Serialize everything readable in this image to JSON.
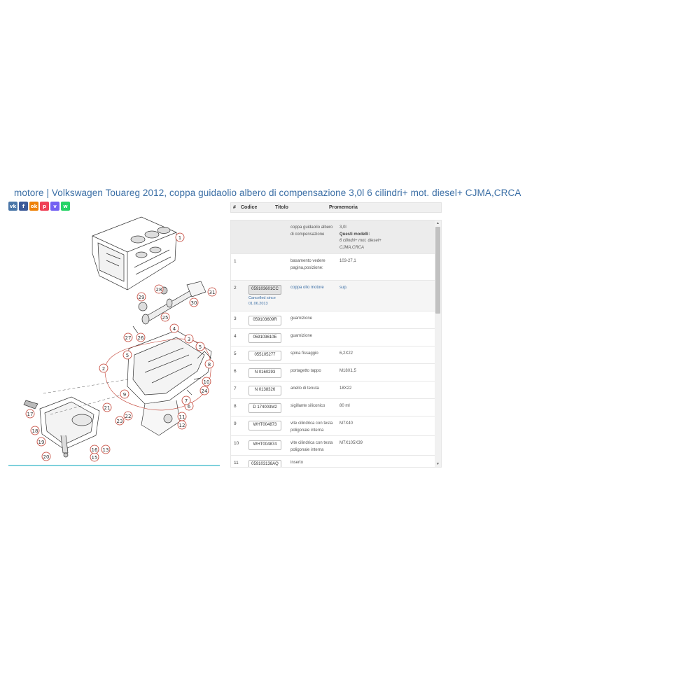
{
  "page": {
    "title": "motore | Volkswagen Touareg 2012, coppa guidaolio albero di compensazione 3,0l 6 cilindri+ mot. diesel+ CJMA,CRCA"
  },
  "share": [
    {
      "name": "vk-icon",
      "glyph": "vk",
      "color": "#4a76a8"
    },
    {
      "name": "facebook-icon",
      "glyph": "f",
      "color": "#3b5998"
    },
    {
      "name": "odnoklassniki-icon",
      "glyph": "ok",
      "color": "#ee8208"
    },
    {
      "name": "pocket-icon",
      "glyph": "p",
      "color": "#ef4056"
    },
    {
      "name": "viber-icon",
      "glyph": "v",
      "color": "#7360f2"
    },
    {
      "name": "whatsapp-icon",
      "glyph": "w",
      "color": "#25d366"
    }
  ],
  "table": {
    "headers": {
      "num": "#",
      "code": "Codice",
      "title": "Titolo",
      "memo": "Promemoria"
    },
    "group": {
      "title": "coppa guidaolio albero di compensazione",
      "memo_value": "3,0l",
      "memo_label": "Questi modelli:",
      "memo_models": "6 cilindri+ mot. diesel+ CJMA,CRCA"
    },
    "rows": [
      {
        "num": "1",
        "code": "",
        "title": "basamento vedere pagina,posizione:",
        "memo": "103-27,1"
      },
      {
        "num": "2",
        "code": "059103601CC",
        "title": "coppa olio motore",
        "memo": "sup.",
        "cancelled": "Cancelled since 01.06.2013"
      },
      {
        "num": "3",
        "code": "059103609R",
        "title": "guarnizione",
        "memo": ""
      },
      {
        "num": "4",
        "code": "059103610E",
        "title": "guarnizione",
        "memo": ""
      },
      {
        "num": "5",
        "code": "055105277",
        "title": "spina fissaggio",
        "memo": "6,2X22"
      },
      {
        "num": "6",
        "code": "N 0160293",
        "title": "portagetto tappo",
        "memo": "M18X1,5"
      },
      {
        "num": "7",
        "code": "N 0138326",
        "title": "anello di tenuta",
        "memo": "18X22"
      },
      {
        "num": "8",
        "code": "D 174003M2",
        "title": "sigillante siliconico",
        "memo": "80 ml"
      },
      {
        "num": "9",
        "code": "WHT004873",
        "title": "vite cilindrica con testa poligonale interna",
        "memo": "M7X40"
      },
      {
        "num": "10",
        "code": "WHT004874",
        "title": "vite cilindrica con testa poligonale interna",
        "memo": "M7X105X39"
      },
      {
        "num": "11",
        "code": "059103138AQ",
        "title": "inserto",
        "memo": ""
      }
    ]
  },
  "diagram": {
    "callouts": [
      "1",
      "2",
      "3",
      "4",
      "5",
      "5",
      "6",
      "7",
      "8",
      "9",
      "10",
      "11",
      "12",
      "13",
      "15",
      "16",
      "17",
      "18",
      "19",
      "20",
      "21",
      "22",
      "23",
      "24",
      "25",
      "26",
      "27",
      "28",
      "29",
      "30",
      "31"
    ]
  },
  "scroll": {
    "up": "▲",
    "down": "▼"
  }
}
